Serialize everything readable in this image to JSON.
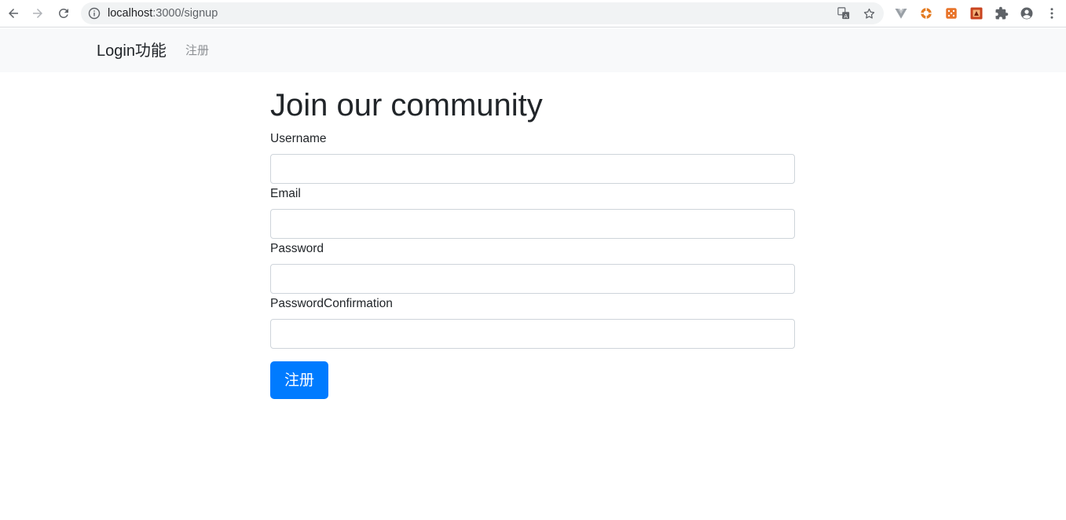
{
  "browser": {
    "url_host": "localhost",
    "url_port_path": ":3000/signup",
    "icons": [
      "back-arrow-icon",
      "forward-arrow-icon",
      "reload-icon",
      "site-info-icon",
      "translate-icon",
      "bookmark-star-icon",
      "vue-devtools-icon",
      "extension-orange-icon",
      "extension-dice-icon",
      "extension-red-icon",
      "extensions-puzzle-icon",
      "profile-icon",
      "menu-kebab-icon"
    ]
  },
  "navbar": {
    "brand": "Login功能",
    "link": "注册"
  },
  "form": {
    "title": "Join our community",
    "fields": [
      {
        "label": "Username",
        "value": "",
        "placeholder": ""
      },
      {
        "label": "Email",
        "value": "",
        "placeholder": ""
      },
      {
        "label": "Password",
        "value": "",
        "placeholder": ""
      },
      {
        "label": "PasswordConfirmation",
        "value": "",
        "placeholder": ""
      }
    ],
    "submit_label": "注册"
  },
  "colors": {
    "primary": "#007bff",
    "navbar_bg": "#f8f9fa",
    "text": "#212529",
    "muted_link": "#8c8f93",
    "input_border": "#ced4da"
  }
}
